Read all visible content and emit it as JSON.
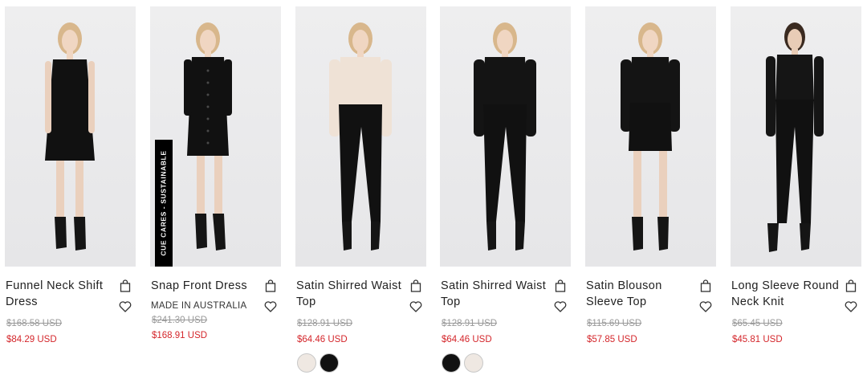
{
  "colors": {
    "sale": "#d4262b",
    "original": "#999999",
    "badge_bg": "#000000"
  },
  "products": [
    {
      "name": "Funnel Neck Shift Dress",
      "original_price": "$168.58 USD",
      "sale_price": "$84.29 USD",
      "outfit": "black-shift-dress"
    },
    {
      "name": "Snap Front Dress",
      "made_in": "MADE IN AUSTRALIA",
      "badge": "CUE CARES - SUSTAINABLE",
      "original_price": "$241.30 USD",
      "sale_price": "$168.91 USD",
      "outfit": "black-button-dress"
    },
    {
      "name": "Satin Shirred Waist Top",
      "original_price": "$128.91 USD",
      "sale_price": "$64.46 USD",
      "outfit": "champagne-satin-top",
      "swatches": [
        {
          "color": "#efe8e2",
          "label": "champagne",
          "selected": false
        },
        {
          "color": "#111111",
          "label": "black",
          "selected": false
        }
      ]
    },
    {
      "name": "Satin Shirred Waist Top",
      "original_price": "$128.91 USD",
      "sale_price": "$64.46 USD",
      "outfit": "black-satin-top",
      "swatches": [
        {
          "color": "#111111",
          "label": "black",
          "selected": false
        },
        {
          "color": "#efe8e2",
          "label": "champagne",
          "selected": false
        }
      ]
    },
    {
      "name": "Satin Blouson Sleeve Top",
      "original_price": "$115.69 USD",
      "sale_price": "$57.85 USD",
      "outfit": "black-blouson-top"
    },
    {
      "name": "Long Sleeve Round Neck Knit",
      "original_price": "$65.45 USD",
      "sale_price": "$45.81 USD",
      "outfit": "black-knit"
    }
  ],
  "icons": {
    "bag": "shopping-bag-icon",
    "heart": "heart-icon"
  }
}
